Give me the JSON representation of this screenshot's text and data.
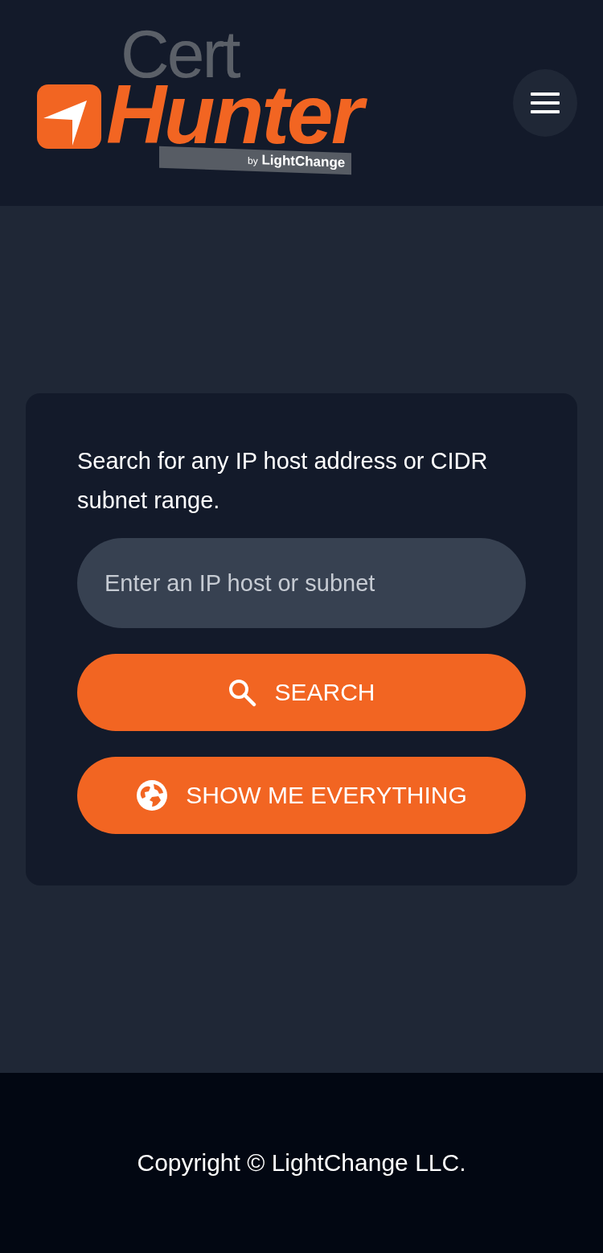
{
  "header": {
    "logo": {
      "top": "Cert",
      "main": "Hunter",
      "by": "by",
      "brand": "LightChange"
    }
  },
  "search_card": {
    "prompt": "Search for any IP host address or CIDR subnet range.",
    "input": {
      "placeholder": "Enter an IP host or subnet"
    },
    "buttons": [
      {
        "kind": "search",
        "label": "SEARCH"
      },
      {
        "kind": "globe",
        "label": "SHOW ME EVERYTHING"
      }
    ]
  },
  "footer": {
    "copyright": "Copyright © LightChange LLC."
  }
}
